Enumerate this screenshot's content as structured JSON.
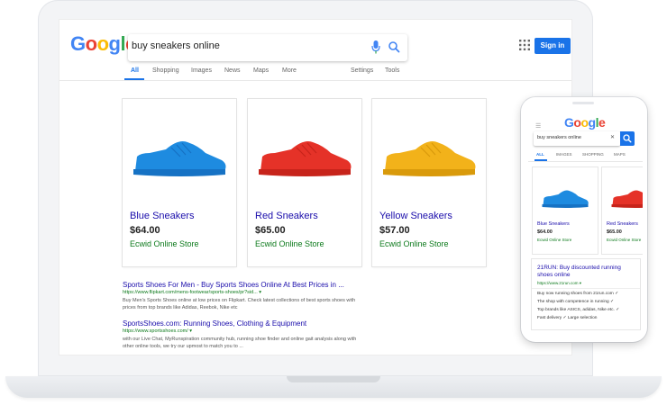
{
  "search": {
    "query": "buy sneakers online"
  },
  "logo": {
    "letters": [
      "G",
      "o",
      "o",
      "g",
      "l",
      "e"
    ],
    "colors": [
      "#4285F4",
      "#EA4335",
      "#FBBC05",
      "#4285F4",
      "#34A853",
      "#EA4335"
    ]
  },
  "header": {
    "signin_label": "Sign in"
  },
  "nav": {
    "tabs": [
      "All",
      "Shopping",
      "Images",
      "News",
      "Maps",
      "More"
    ],
    "right": [
      "Settings",
      "Tools"
    ],
    "active": "All"
  },
  "products": [
    {
      "title": "Blue Sneakers",
      "price": "$64.00",
      "store": "Ecwid Online Store",
      "color": "#1e8be0",
      "sole": "#1672c4"
    },
    {
      "title": "Red Sneakers",
      "price": "$65.00",
      "store": "Ecwid Online Store",
      "color": "#e53228",
      "sole": "#c7241b"
    },
    {
      "title": "Yellow Sneakers",
      "price": "$57.00",
      "store": "Ecwid Online Store",
      "color": "#f2b21a",
      "sole": "#d99a0b"
    }
  ],
  "results": [
    {
      "title": "Sports Shoes For Men - Buy Sports Shoes Online At Best Prices in ...",
      "url": "https://www.flipkart.com/mens-footwear/sports-shoes/pr?sid... ▾",
      "snippet": "Buy Men's Sports Shoes online at low prices on Flipkart. Check latest collections of best sports shoes with prices from top brands like Adidas, Reebok, Nike etc"
    },
    {
      "title": "SportsShoes.com: Running Shoes, Clothing & Equipment",
      "url": "https://www.sportsshoes.com/ ▾",
      "snippet": "with our Live Chat, MyRunspiration community hub, running shoe finder and online gait analysis along with other online tools, we try our upmost to match you to ..."
    }
  ],
  "phone": {
    "search": "buy sneakers online",
    "clear_icon": "✕",
    "tabs": [
      "ALL",
      "IMAGES",
      "SHOPPING",
      "MAPS"
    ],
    "products": [
      {
        "title": "Blue Sneakers",
        "price": "$64.00",
        "store": "Ecwid Online Store",
        "color": "#1e8be0"
      },
      {
        "title": "Red Sneakers",
        "price": "$65.00",
        "store": "Ecwid Online Store",
        "color": "#e53228"
      }
    ],
    "result": {
      "title": "21RUN: Buy discounted running shoes online",
      "url": "https://www.21run.com ▾",
      "lines": [
        "Buy now running shoes from 21run.com ✓",
        "The shop with competence in running ✓",
        "Top brands like ASICS, adidas, Nike etc. ✓",
        "Fast delivery ✓ Large selection"
      ]
    }
  }
}
